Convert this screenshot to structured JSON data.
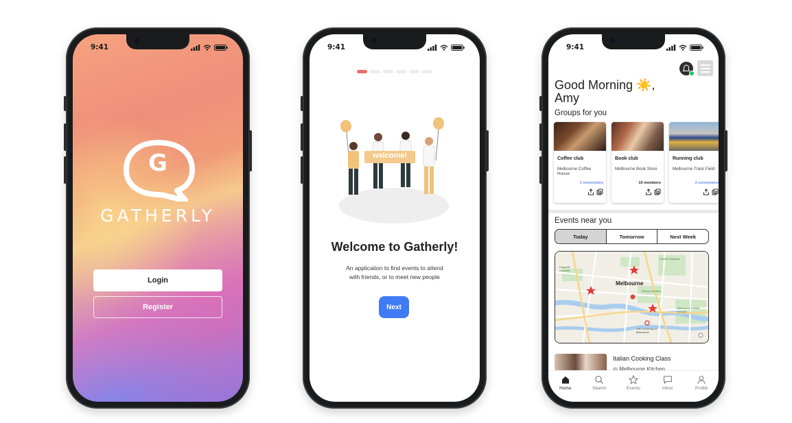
{
  "colors": {
    "accent": "#3f7bf5",
    "progress_active": "#ef6a6a",
    "online": "#22c55e"
  },
  "status_bar": {
    "time": "9:41"
  },
  "splash": {
    "logo_letter": "G",
    "brand": "GATHERLY",
    "login_label": "Login",
    "register_label": "Register"
  },
  "onboarding": {
    "progress": {
      "current_step": 1,
      "total_steps": 6
    },
    "banner_text": "welcome!",
    "title": "Welcome to Gatherly!",
    "subtitle_line1": "An application to find events to attend",
    "subtitle_line2": "with friends, or to meet new people",
    "next_label": "Next"
  },
  "home": {
    "greeting_line1": "Good Morning ☀️,",
    "greeting_line2": "Amy",
    "groups_title": "Groups for you",
    "groups": [
      {
        "name": "Coffee club",
        "location": "Melbourne Coffee House",
        "meta": "2 connections",
        "icon": "coffee-photo"
      },
      {
        "name": "Book club",
        "location": "Melbourne Book Store",
        "meta": "10 members",
        "icon": "book-photo"
      },
      {
        "name": "Running club",
        "location": "Melbourne Track Field",
        "meta": "3 connections",
        "icon": "running-photo"
      }
    ],
    "events_title": "Events near you",
    "tabs": [
      "Today",
      "Tomorrow",
      "Next Week"
    ],
    "active_tab": "Today",
    "map": {
      "city_label": "Melbourne",
      "place_labels": [
        "Flagstaff Gardens",
        "Fitzroy Gardens",
        "Melbourne Cricket Ground",
        "The University of Melbourne",
        "Carlton Gardens"
      ]
    },
    "event": {
      "title": "Italian Cooking Class",
      "location": "Melbourne Kitchen"
    },
    "nav": [
      {
        "label": "Home",
        "icon": "home-icon"
      },
      {
        "label": "Search",
        "icon": "search-icon"
      },
      {
        "label": "Events",
        "icon": "star-icon"
      },
      {
        "label": "Inbox",
        "icon": "chat-icon"
      },
      {
        "label": "Profile",
        "icon": "profile-icon"
      }
    ],
    "active_nav": "Home"
  }
}
